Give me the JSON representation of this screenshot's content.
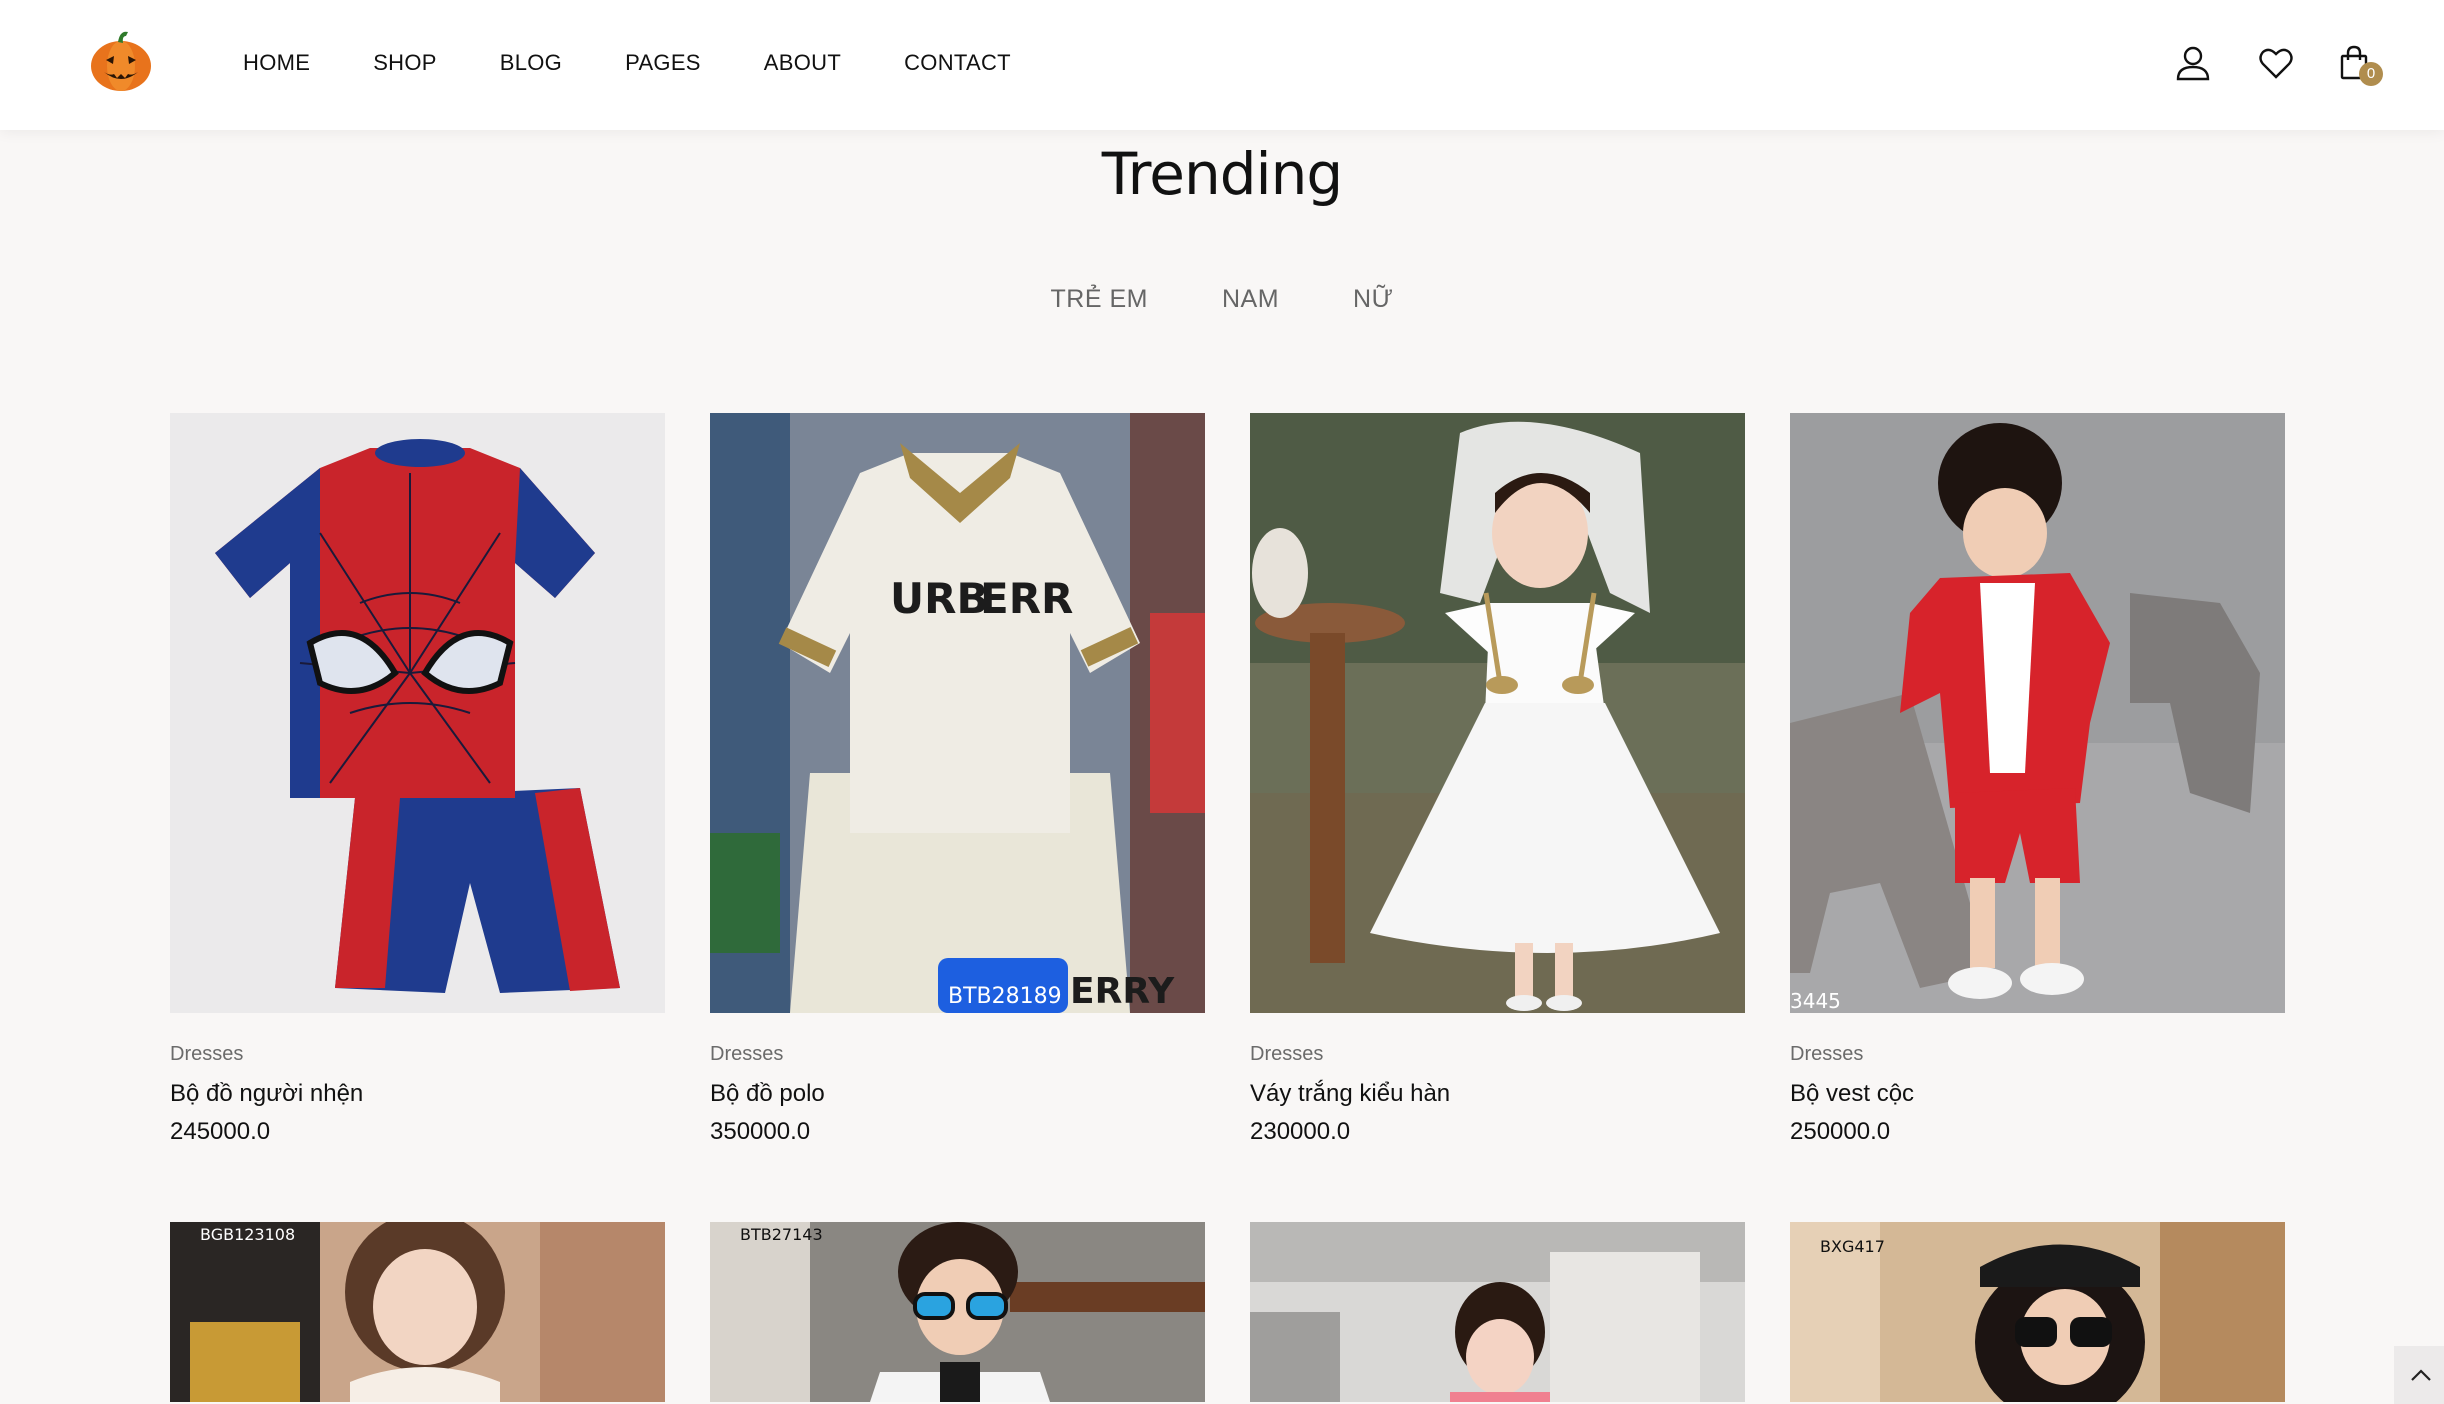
{
  "nav": {
    "items": [
      {
        "label": "HOME"
      },
      {
        "label": "SHOP"
      },
      {
        "label": "BLOG"
      },
      {
        "label": "PAGES"
      },
      {
        "label": "ABOUT"
      },
      {
        "label": "CONTACT"
      }
    ],
    "cart_count": "0"
  },
  "section": {
    "title": "Trending",
    "tabs": [
      {
        "label": "TRẺ EM"
      },
      {
        "label": "NAM"
      },
      {
        "label": "NỮ"
      }
    ]
  },
  "products": [
    {
      "category": "Dresses",
      "name": "Bộ đồ người nhện",
      "price": "245000.0"
    },
    {
      "category": "Dresses",
      "name": "Bộ đồ polo",
      "price": "350000.0",
      "image_text": [
        "URB",
        "ERR",
        "BTB28189",
        "ERRY"
      ]
    },
    {
      "category": "Dresses",
      "name": "Váy trắng kiểu hàn",
      "price": "230000.0"
    },
    {
      "category": "Dresses",
      "name": "Bộ vest cộc",
      "price": "250000.0",
      "image_text": [
        "3445"
      ]
    }
  ],
  "products_row2": [
    {
      "image_text": "BGB123108"
    },
    {
      "image_text": "BTB27143"
    },
    {
      "image_text": ""
    },
    {
      "image_text": "BXG417"
    }
  ],
  "colors": {
    "background": "#f9f7f6",
    "header": "#ffffff",
    "badge": "#b08d4e",
    "tab_text": "#666666"
  }
}
